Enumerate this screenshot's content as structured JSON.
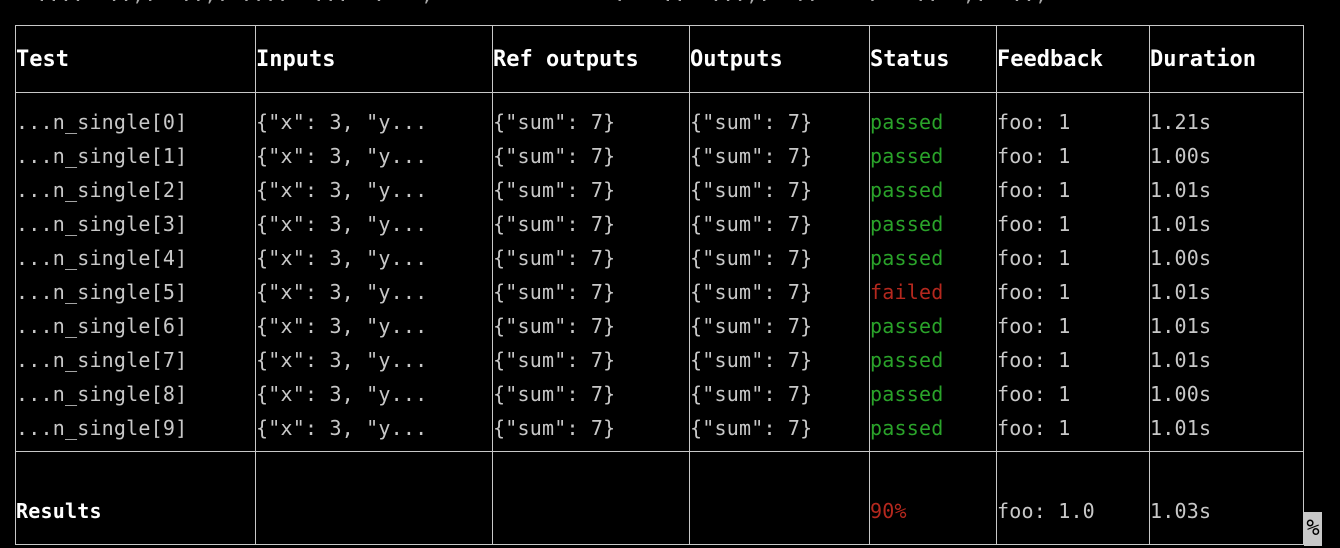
{
  "terminal": {
    "scrollback_line": "   ....  ..,.  ..,. ....  ...  .   ,               .   ..  ...,.  ..    .   ..  ,.  ..,",
    "cursor_glyph": "%"
  },
  "table": {
    "columns": [
      "Test",
      "Inputs",
      "Ref outputs",
      "Outputs",
      "Status",
      "Feedback",
      "Duration"
    ],
    "rows": [
      {
        "test": "...n_single[0]",
        "inputs": "{\"x\": 3, \"y...",
        "ref_outputs": "{\"sum\": 7}",
        "outputs": "{\"sum\": 7}",
        "status": "passed",
        "feedback": "foo: 1",
        "duration": "1.21s"
      },
      {
        "test": "...n_single[1]",
        "inputs": "{\"x\": 3, \"y...",
        "ref_outputs": "{\"sum\": 7}",
        "outputs": "{\"sum\": 7}",
        "status": "passed",
        "feedback": "foo: 1",
        "duration": "1.00s"
      },
      {
        "test": "...n_single[2]",
        "inputs": "{\"x\": 3, \"y...",
        "ref_outputs": "{\"sum\": 7}",
        "outputs": "{\"sum\": 7}",
        "status": "passed",
        "feedback": "foo: 1",
        "duration": "1.01s"
      },
      {
        "test": "...n_single[3]",
        "inputs": "{\"x\": 3, \"y...",
        "ref_outputs": "{\"sum\": 7}",
        "outputs": "{\"sum\": 7}",
        "status": "passed",
        "feedback": "foo: 1",
        "duration": "1.01s"
      },
      {
        "test": "...n_single[4]",
        "inputs": "{\"x\": 3, \"y...",
        "ref_outputs": "{\"sum\": 7}",
        "outputs": "{\"sum\": 7}",
        "status": "passed",
        "feedback": "foo: 1",
        "duration": "1.00s"
      },
      {
        "test": "...n_single[5]",
        "inputs": "{\"x\": 3, \"y...",
        "ref_outputs": "{\"sum\": 7}",
        "outputs": "{\"sum\": 7}",
        "status": "failed",
        "feedback": "foo: 1",
        "duration": "1.01s"
      },
      {
        "test": "...n_single[6]",
        "inputs": "{\"x\": 3, \"y...",
        "ref_outputs": "{\"sum\": 7}",
        "outputs": "{\"sum\": 7}",
        "status": "passed",
        "feedback": "foo: 1",
        "duration": "1.01s"
      },
      {
        "test": "...n_single[7]",
        "inputs": "{\"x\": 3, \"y...",
        "ref_outputs": "{\"sum\": 7}",
        "outputs": "{\"sum\": 7}",
        "status": "passed",
        "feedback": "foo: 1",
        "duration": "1.01s"
      },
      {
        "test": "...n_single[8]",
        "inputs": "{\"x\": 3, \"y...",
        "ref_outputs": "{\"sum\": 7}",
        "outputs": "{\"sum\": 7}",
        "status": "passed",
        "feedback": "foo: 1",
        "duration": "1.00s"
      },
      {
        "test": "...n_single[9]",
        "inputs": "{\"x\": 3, \"y...",
        "ref_outputs": "{\"sum\": 7}",
        "outputs": "{\"sum\": 7}",
        "status": "passed",
        "feedback": "foo: 1",
        "duration": "1.01s"
      }
    ],
    "summary": {
      "label": "Results",
      "inputs": "",
      "ref_outputs": "",
      "outputs": "",
      "status": "90%",
      "feedback": "foo: 1.0",
      "duration": "1.03s"
    }
  },
  "colors": {
    "passed": "#2aa32a",
    "failed": "#b5281e",
    "summary_rate": "#b5281e",
    "border": "#c8c8c8",
    "text": "#c8c8c8",
    "header_text": "#ffffff",
    "background": "#000000"
  }
}
